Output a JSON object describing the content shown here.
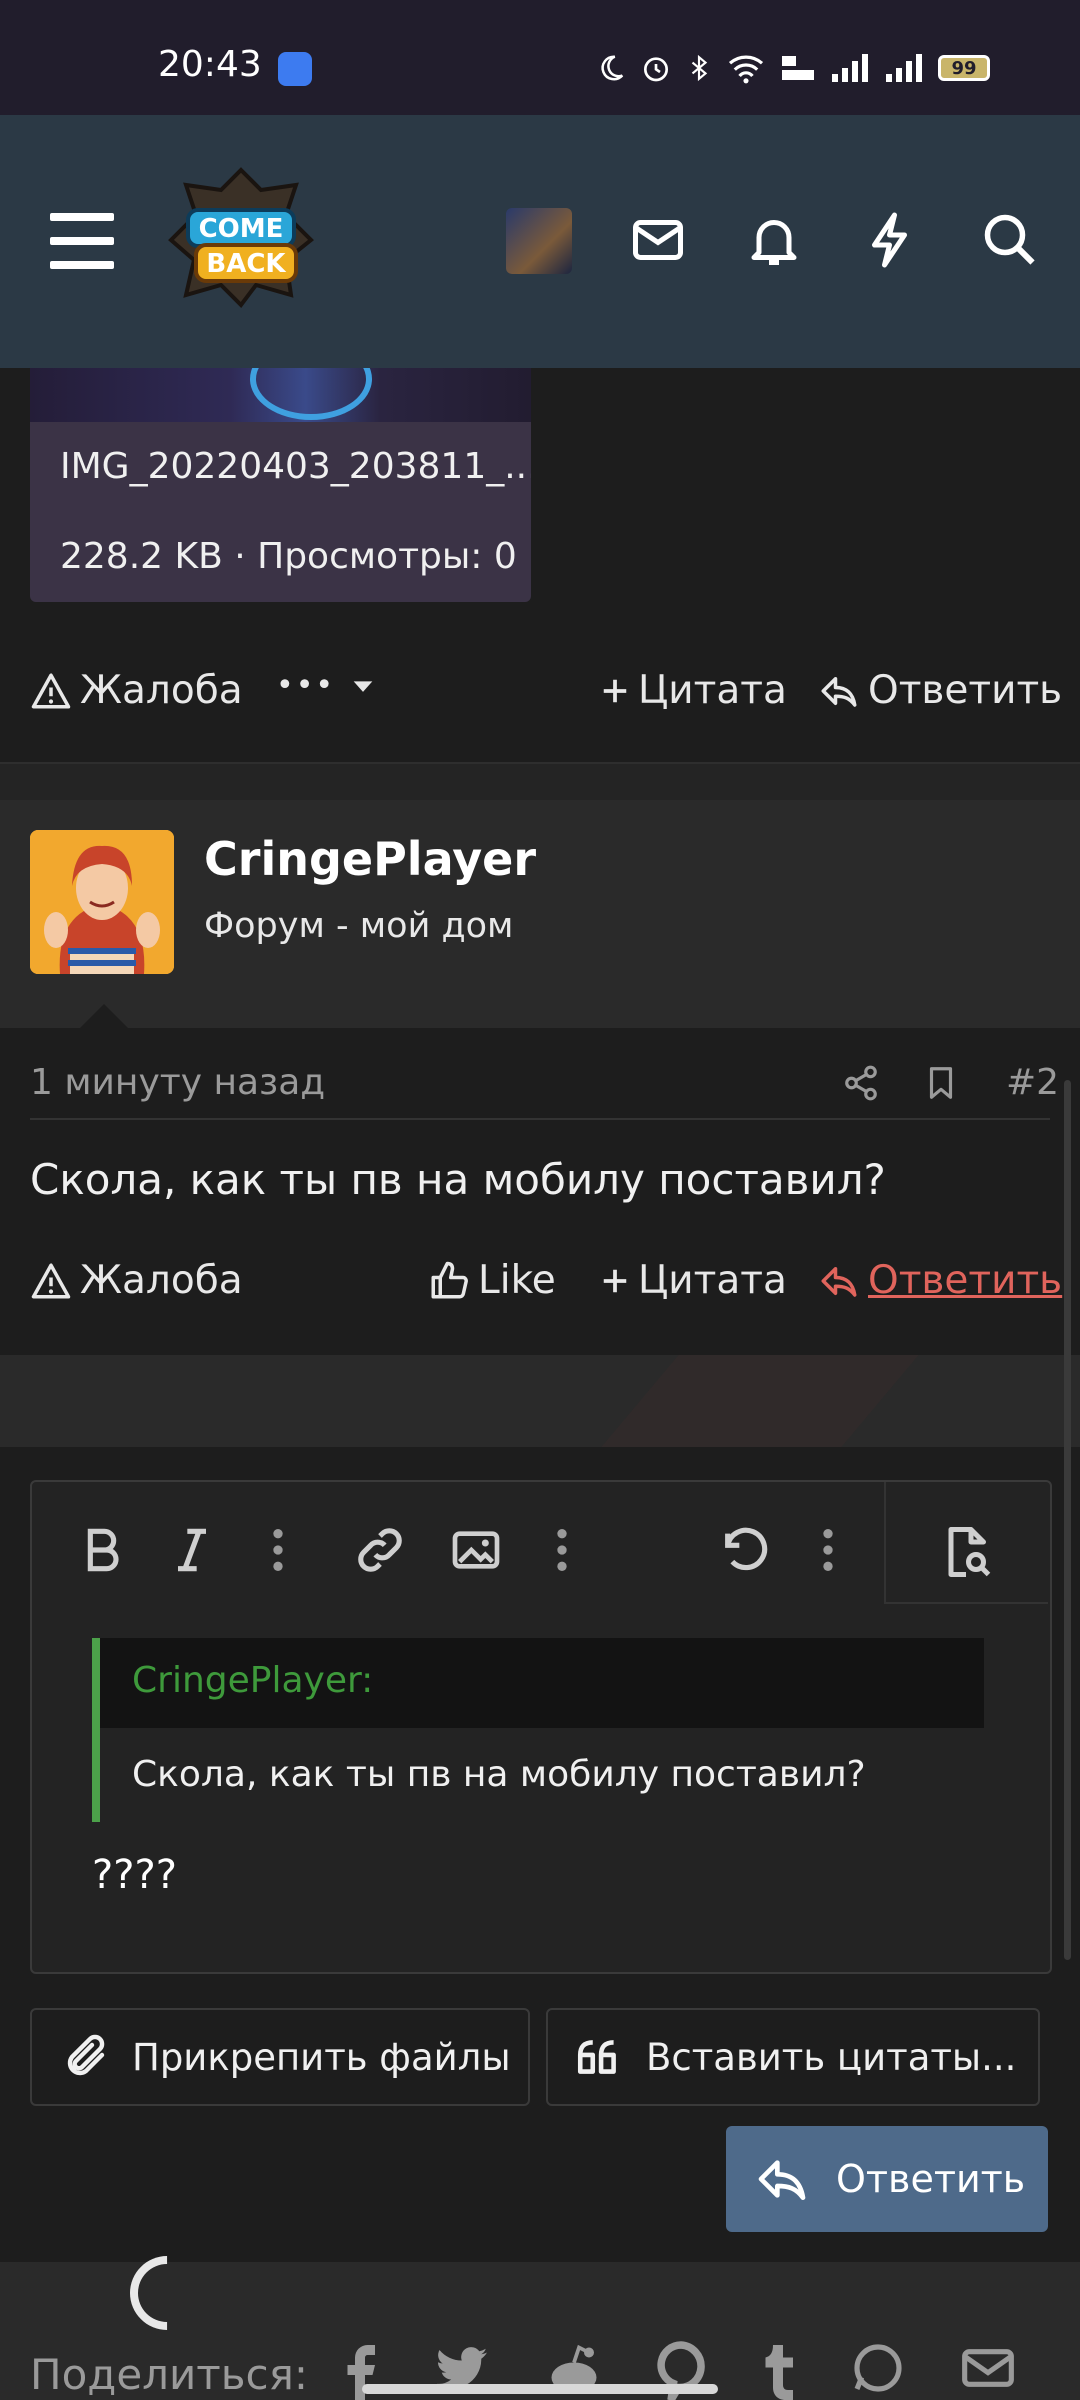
{
  "status_bar": {
    "time": "20:43",
    "battery": "99"
  },
  "header": {
    "icons": [
      "menu-icon",
      "logo",
      "avatar",
      "mail-icon",
      "bell-icon",
      "lightning-icon",
      "search-icon"
    ]
  },
  "attachment": {
    "filename": "IMG_20220403_203811_...",
    "meta": "228.2 KB · Просмотры: 0"
  },
  "post1_actions": {
    "report": "Жалоба",
    "more": "•••",
    "quote": "Цитата",
    "reply": "Ответить"
  },
  "post2": {
    "username": "CringePlayer",
    "user_title": "Форум - мой дом",
    "time": "1 минуту назад",
    "number": "#2",
    "text": "Скола, как ты пв на мобилу поставил?",
    "actions": {
      "report": "Жалоба",
      "like": "Like",
      "quote": "Цитата",
      "reply": "Ответить"
    }
  },
  "editor": {
    "quote_author": "CringePlayer:",
    "quote_text": "Скола, как ты пв на мобилу поставил?",
    "text": "????"
  },
  "buttons": {
    "attach": "Прикрепить файлы",
    "insert_quotes": "Вставить цитаты...",
    "submit": "Ответить"
  },
  "footer": {
    "share_label": "Поделиться:"
  },
  "colors": {
    "accent_red": "#e0645c",
    "quote_green": "#3e9a3b",
    "header_bg": "#2b3945",
    "submit_bg": "#4e6a8a"
  }
}
